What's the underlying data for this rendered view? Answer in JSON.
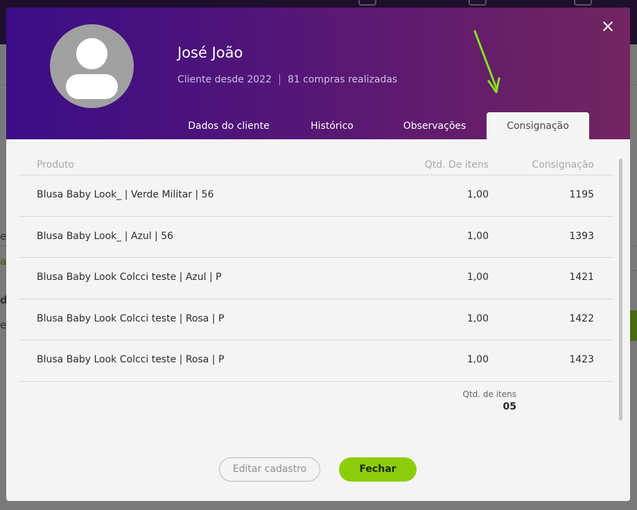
{
  "client": {
    "name": "José João",
    "since": "Cliente desde 2022",
    "purchases": "81 compras realizadas"
  },
  "tabs": [
    {
      "label": "Dados do cliente",
      "active": false
    },
    {
      "label": "Histórico",
      "active": false
    },
    {
      "label": "Observações",
      "active": false
    },
    {
      "label": "Consignação",
      "active": true
    }
  ],
  "table": {
    "headers": {
      "product": "Produto",
      "qty": "Qtd. De itens",
      "consignment": "Consignação"
    },
    "rows": [
      {
        "product": "Blusa Baby Look_ | Verde Militar | 56",
        "qty": "1,00",
        "consignment": "1195"
      },
      {
        "product": "Blusa Baby Look_ | Azul | 56",
        "qty": "1,00",
        "consignment": "1393"
      },
      {
        "product": "Blusa Baby Look Colcci teste | Azul | P",
        "qty": "1,00",
        "consignment": "1421"
      },
      {
        "product": "Blusa Baby Look Colcci teste | Rosa | P",
        "qty": "1,00",
        "consignment": "1422"
      },
      {
        "product": "Blusa Baby Look Colcci teste | Rosa | P",
        "qty": "1,00",
        "consignment": "1423"
      }
    ]
  },
  "summary": {
    "label": "Qtd. de itens",
    "value": "05"
  },
  "buttons": {
    "edit": "Editar cadastro",
    "close": "Fechar"
  },
  "background": {
    "fragments": [
      "e",
      "at",
      "d",
      "es"
    ]
  },
  "icons": {
    "close": "close-icon",
    "avatar": "user-avatar-icon",
    "arrow": "arrow-annotation-icon"
  },
  "colors": {
    "header_start": "#3a0d87",
    "header_end": "#722560",
    "accent_green": "#8ccd0b",
    "arrow_green": "#86e81a"
  }
}
